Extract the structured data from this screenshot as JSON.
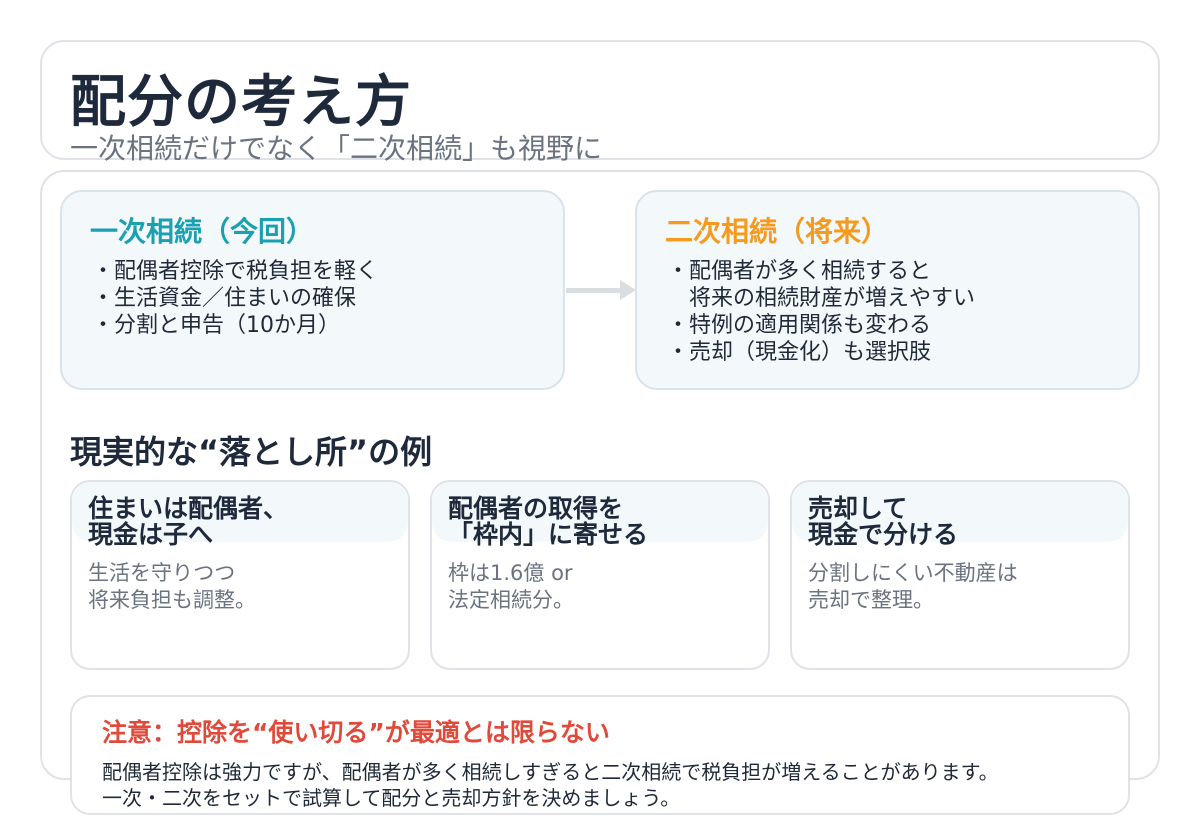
{
  "header": {
    "title": "配分の考え方",
    "subtitle": "一次相続だけでなく「二次相続」も視野に"
  },
  "stages": {
    "first": {
      "heading": "一次相続（今回）",
      "items": [
        "・配偶者控除で税負担を軽く",
        "・生活資金／住まいの確保",
        "・分割と申告（10か月）"
      ]
    },
    "second": {
      "heading": "二次相続（将来）",
      "items": [
        "・配偶者が多く相続すると",
        "　将来の相続財産が増えやすい",
        "・特例の適用関係も変わる",
        "・売却（現金化）も選択肢"
      ]
    }
  },
  "examples": {
    "heading": "現実的な“落とし所”の例",
    "cards": [
      {
        "title": "住まいは配偶者、\n現金は子へ",
        "description": "生活を守りつつ\n将来負担も調整。"
      },
      {
        "title": "配偶者の取得を\n「枠内」に寄せる",
        "description": "枠は1.6億 or\n法定相続分。"
      },
      {
        "title": "売却して\n現金で分ける",
        "description": "分割しにくい不動産は\n売却で整理。"
      }
    ]
  },
  "note": {
    "heading": "注意：控除を“使い切る”が最適とは限らない",
    "body": "配偶者控除は強力ですが、配偶者が多く相続しすぎると二次相続で税負担が増えることがあります。\n一次・二次をセットで試算して配分と売却方針を決めましょう。"
  },
  "colors": {
    "first_accent": "#1aa0b0",
    "second_accent": "#f59a1e",
    "warning": "#e04a3a"
  }
}
